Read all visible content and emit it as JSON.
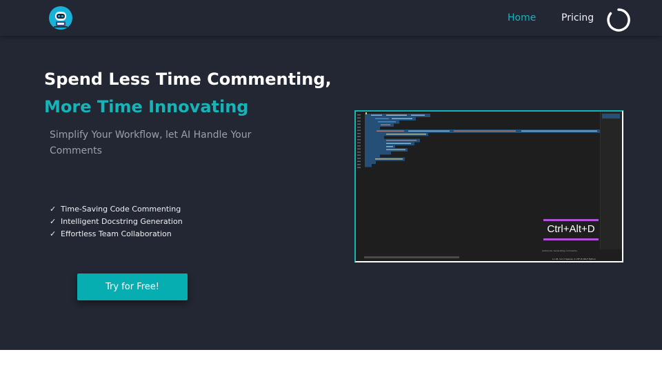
{
  "nav": {
    "logo_icon": "robot-logo-icon",
    "links": [
      {
        "label": "Home",
        "active": true
      },
      {
        "label": "Pricing",
        "active": false
      }
    ],
    "loader_icon": "loading-spinner-icon"
  },
  "hero": {
    "title_line1": "Spend Less Time Commenting,",
    "title_line2": "More Time Innovating",
    "subtitle": "Simplify Your Workflow, let AI Handle Your Comments",
    "features": [
      "Time-Saving Code Commenting",
      "Intelligent Docstring Generation",
      "Effortless Team Collaboration"
    ],
    "check_glyph": "✓",
    "cta_label": "Try for Free!"
  },
  "preview": {
    "shortcut_label": "Ctrl+Alt+D",
    "status_text": "AutoCode: Generating comments...",
    "status_text2": "Ln 18, Col 2   Spaces: 4   UTF-8   CRLF   Python"
  },
  "colors": {
    "accent": "#16b3b8",
    "cta": "#06aeb2",
    "background": "#232733",
    "shortcut_underline": "#b252d6"
  }
}
